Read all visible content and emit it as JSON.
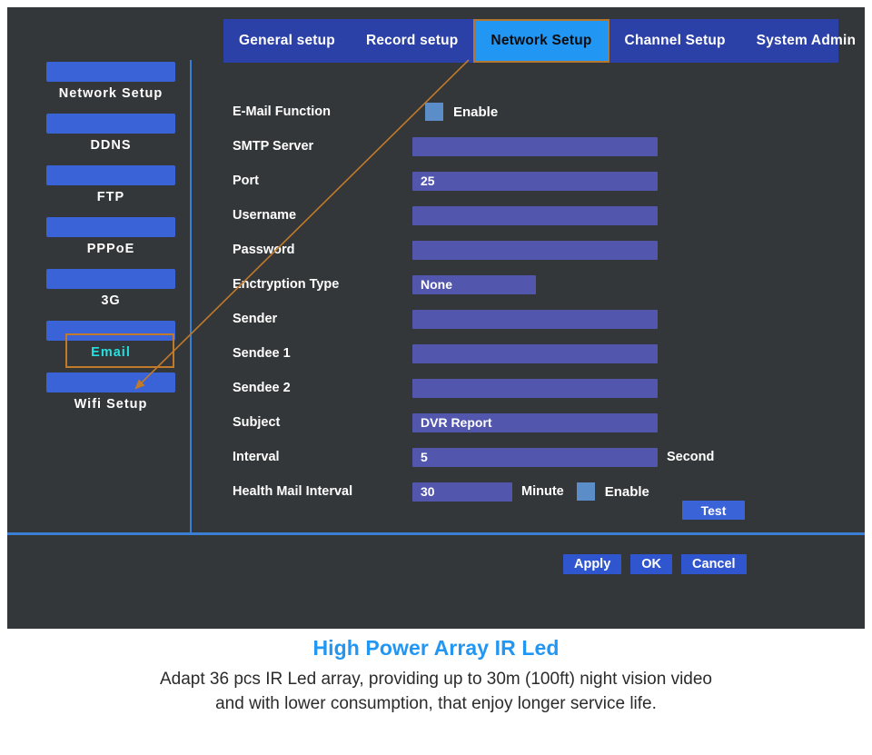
{
  "tabs": [
    {
      "label": "General setup",
      "active": false
    },
    {
      "label": "Record setup",
      "active": false
    },
    {
      "label": "Network Setup",
      "active": true
    },
    {
      "label": "Channel Setup",
      "active": false
    },
    {
      "label": "System Admin",
      "active": false
    }
  ],
  "sidebar": {
    "items": [
      {
        "label": "Network  Setup",
        "selected": false
      },
      {
        "label": "DDNS",
        "selected": false
      },
      {
        "label": "FTP",
        "selected": false
      },
      {
        "label": "PPPoE",
        "selected": false
      },
      {
        "label": "3G",
        "selected": false
      },
      {
        "label": "Email",
        "selected": true
      },
      {
        "label": "Wifi Setup",
        "selected": false
      }
    ]
  },
  "form": {
    "email_function": {
      "label": "E-Mail Function",
      "checkbox_label": "Enable"
    },
    "smtp_server": {
      "label": "SMTP Server",
      "value": ""
    },
    "port": {
      "label": "Port",
      "value": "25"
    },
    "username": {
      "label": "Username",
      "value": ""
    },
    "password": {
      "label": "Password",
      "value": ""
    },
    "encryption_type": {
      "label": "Enctryption Type",
      "value": "None"
    },
    "sender": {
      "label": "Sender",
      "value": ""
    },
    "sendee1": {
      "label": "Sendee 1",
      "value": ""
    },
    "sendee2": {
      "label": "Sendee 2",
      "value": ""
    },
    "subject": {
      "label": "Subject",
      "value": "DVR Report"
    },
    "interval": {
      "label": "Interval",
      "value": "5",
      "unit": "Second"
    },
    "health_mail_interval": {
      "label": "Health Mail Interval",
      "value": "30",
      "unit": "Minute",
      "checkbox_label": "Enable"
    }
  },
  "buttons": {
    "test": "Test",
    "apply": "Apply",
    "ok": "OK",
    "cancel": "Cancel"
  },
  "caption": {
    "title": "High Power Array IR Led",
    "body": "Adapt 36 pcs IR Led array, providing up to 30m (100ft) night vision video and with lower consumption, that enjoy longer service life."
  },
  "colors": {
    "panel_bg": "#343739",
    "tab_bar": "#2c41a8",
    "tab_active": "#2196f3",
    "highlight_outline": "#c07a2a",
    "selected_text": "#26e0e0",
    "input_bg": "#5257ad",
    "button_blue": "#3a63d8",
    "divider_blue": "#3b7fd4",
    "checkbox_blue": "#5b8ec9",
    "caption_title": "#2196f3"
  }
}
